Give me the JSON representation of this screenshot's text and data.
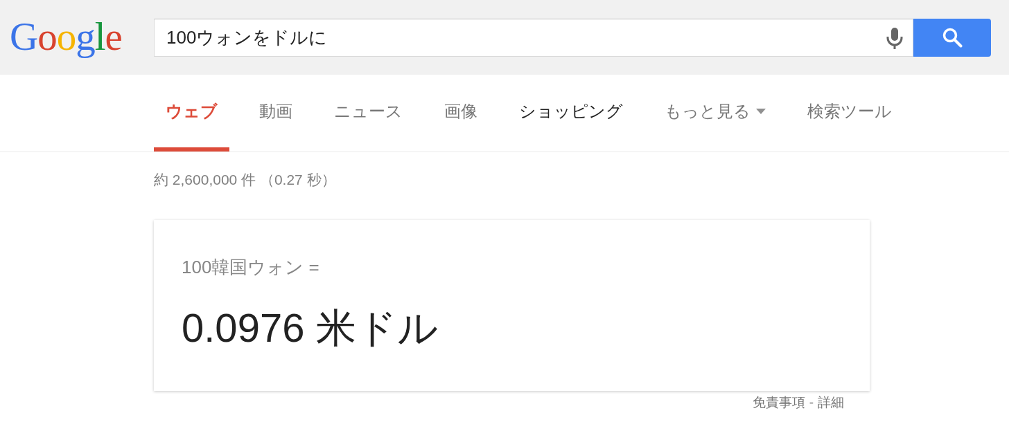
{
  "header": {
    "logo": "Google",
    "search": {
      "value": "100ウォンをドルに"
    }
  },
  "tabs": [
    {
      "label": "ウェブ",
      "selected": true,
      "hovered": false,
      "has_menu": false
    },
    {
      "label": "動画",
      "selected": false,
      "hovered": false,
      "has_menu": false
    },
    {
      "label": "ニュース",
      "selected": false,
      "hovered": false,
      "has_menu": false
    },
    {
      "label": "画像",
      "selected": false,
      "hovered": false,
      "has_menu": false
    },
    {
      "label": "ショッピング",
      "selected": false,
      "hovered": true,
      "has_menu": false
    },
    {
      "label": "もっと見る",
      "selected": false,
      "hovered": false,
      "has_menu": true
    },
    {
      "label": "検索ツール",
      "selected": false,
      "hovered": false,
      "has_menu": false
    }
  ],
  "result_stats": "約 2,600,000 件 （0.27 秒）",
  "converter": {
    "source": "100韓国ウォン =",
    "result": "0.0976 米ドル"
  },
  "footer": {
    "links": [
      "免責事項",
      "詳細"
    ],
    "separator": "-"
  }
}
